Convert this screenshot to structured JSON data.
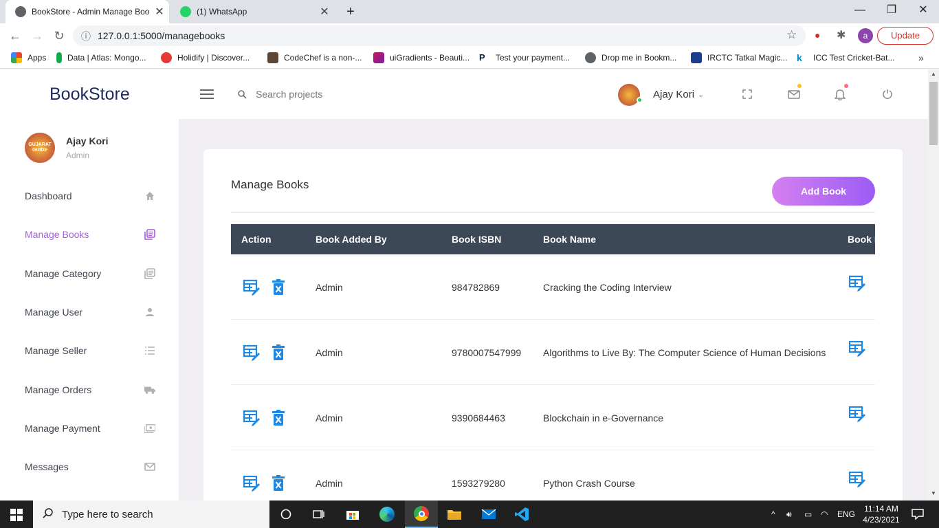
{
  "browser": {
    "tabs": [
      {
        "title": "BookStore - Admin Manage Boo",
        "active": true
      },
      {
        "title": "(1) WhatsApp",
        "active": false
      }
    ],
    "new_tab": "+",
    "url": "127.0.0.1:5000/managebooks",
    "update_label": "Update",
    "profile_letter": "a",
    "bookmarks": [
      {
        "label": "Apps",
        "color": "#e8453c"
      },
      {
        "label": "Data | Atlas: Mongo...",
        "color": "#13aa52"
      },
      {
        "label": "Holidify | Discover...",
        "color": "#e53935"
      },
      {
        "label": "CodeChef is a non-...",
        "color": "#5b4638"
      },
      {
        "label": "uiGradients - Beauti...",
        "color": "#c2185b"
      },
      {
        "label": "Test your payment...",
        "color": "#0a1f44"
      },
      {
        "label": "Drop me in Bookm...",
        "color": "#5f6368"
      },
      {
        "label": "IRCTC Tatkal Magic...",
        "color": "#1a3c8f"
      },
      {
        "label": "ICC Test Cricket-Bat...",
        "color": "#0288d1"
      }
    ]
  },
  "app": {
    "brand": "BookStore",
    "search_placeholder": "Search projects",
    "user_name": "Ajay Kori",
    "avatar_text": "GUJARAT GUIDE",
    "sidebar": {
      "user_name": "Ajay Kori",
      "user_role": "Admin",
      "items": [
        {
          "label": "Dashboard",
          "icon": "home-icon"
        },
        {
          "label": "Manage Books",
          "icon": "books-icon",
          "active": true
        },
        {
          "label": "Manage Category",
          "icon": "category-icon"
        },
        {
          "label": "Manage User",
          "icon": "user-icon"
        },
        {
          "label": "Manage Seller",
          "icon": "list-icon"
        },
        {
          "label": "Manage Orders",
          "icon": "truck-icon"
        },
        {
          "label": "Manage Payment",
          "icon": "payment-icon"
        },
        {
          "label": "Messages",
          "icon": "mail-icon"
        }
      ]
    },
    "page": {
      "title": "Manage Books",
      "add_button": "Add Book",
      "columns": [
        "Action",
        "Book Added By",
        "Book ISBN",
        "Book Name",
        "Book I"
      ],
      "rows": [
        {
          "added_by": "Admin",
          "isbn": "984782869",
          "name": "Cracking the Coding Interview"
        },
        {
          "added_by": "Admin",
          "isbn": "9780007547999",
          "name": "Algorithms to Live By: The Computer Science of Human Decisions"
        },
        {
          "added_by": "Admin",
          "isbn": "9390684463",
          "name": "Blockchain in e-Governance"
        },
        {
          "added_by": "Admin",
          "isbn": "1593279280",
          "name": "Python Crash Course"
        }
      ]
    },
    "colors": {
      "accent": "#a95cde",
      "header": "#3c4757",
      "icon_blue": "#1e88e5"
    }
  },
  "taskbar": {
    "search_placeholder": "Type here to search",
    "language": "ENG",
    "time": "11:14 AM",
    "date": "4/23/2021"
  }
}
